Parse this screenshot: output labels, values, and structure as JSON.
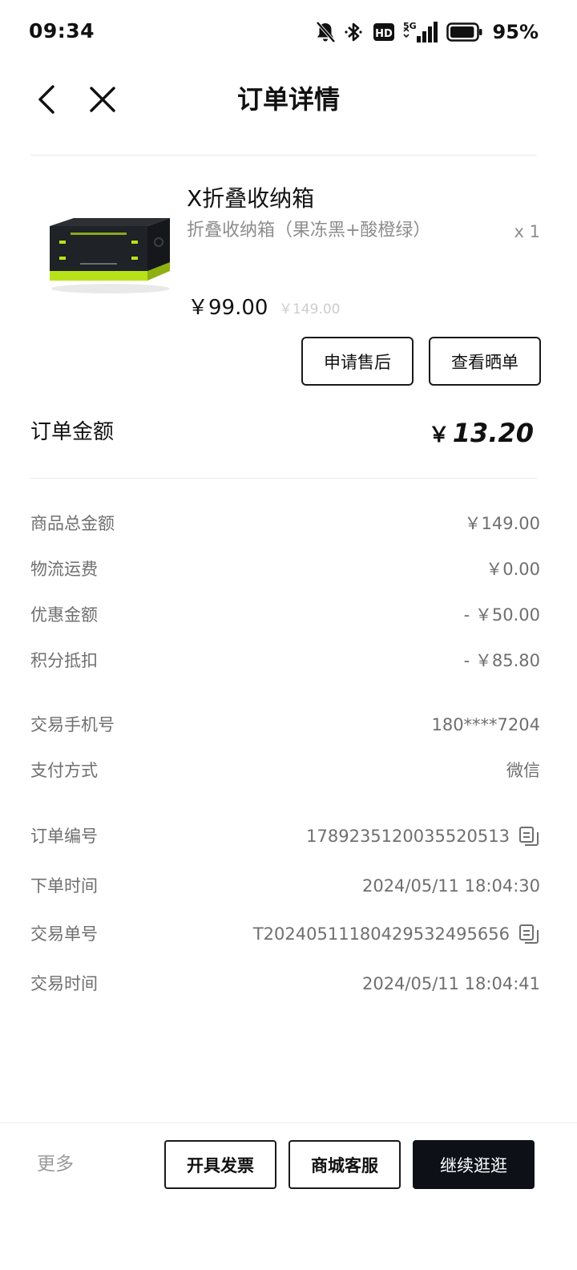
{
  "status_bar": {
    "time": "09:34",
    "network": "5G",
    "hd_badge": "HD",
    "battery_percent": "95%",
    "battery_level": 0.95,
    "icons": [
      "bell-muted-icon",
      "bluetooth-icon",
      "hd-icon",
      "signal-icon",
      "battery-icon"
    ]
  },
  "nav": {
    "title": "订单详情",
    "back_icon": "chevron-left-icon",
    "close_icon": "close-icon"
  },
  "product": {
    "name": "X折叠收纳箱",
    "spec": "折叠收纳箱（果冻黑+酸橙绿）",
    "quantity": "x 1",
    "price": "￥99.00",
    "original_price": "￥149.00",
    "image_icon": "storage-box-image",
    "image_colors": {
      "body": "#1f2226",
      "accent": "#b7e21a"
    }
  },
  "actions": {
    "after_sale": "申请售后",
    "view_review": "查看晒单"
  },
  "order_amount": {
    "label": "订单金额",
    "currency": "￥",
    "value": "13.20"
  },
  "fee_rows": [
    {
      "label": "商品总金额",
      "value": "￥149.00"
    },
    {
      "label": "物流运费",
      "value": "￥0.00"
    },
    {
      "label": "优惠金额",
      "value": "- ￥50.00"
    },
    {
      "label": "积分抵扣",
      "value": "- ￥85.80"
    }
  ],
  "payment_rows": [
    {
      "label": "交易手机号",
      "value": "180****7204"
    },
    {
      "label": "支付方式",
      "value": "微信"
    }
  ],
  "order_rows": [
    {
      "label": "订单编号",
      "value": "1789235120035520513",
      "copy_icon": "copy-icon"
    },
    {
      "label": "下单时间",
      "value": "2024/05/11 18:04:30"
    },
    {
      "label": "交易单号",
      "value": "T2024051118042953249565­6",
      "copy_icon": "copy-icon"
    },
    {
      "label": "交易时间",
      "value": "2024/05/11 18:04:41"
    }
  ],
  "bottom_bar": {
    "more": "更多",
    "invoice": "开具发票",
    "service": "商城客服",
    "continue": "继续逛逛"
  },
  "colors": {
    "primary_button": "#0d1117",
    "text_secondary": "#6f6f6f",
    "text_muted": "#8d8d8d",
    "accent_lime": "#b7e21a"
  }
}
